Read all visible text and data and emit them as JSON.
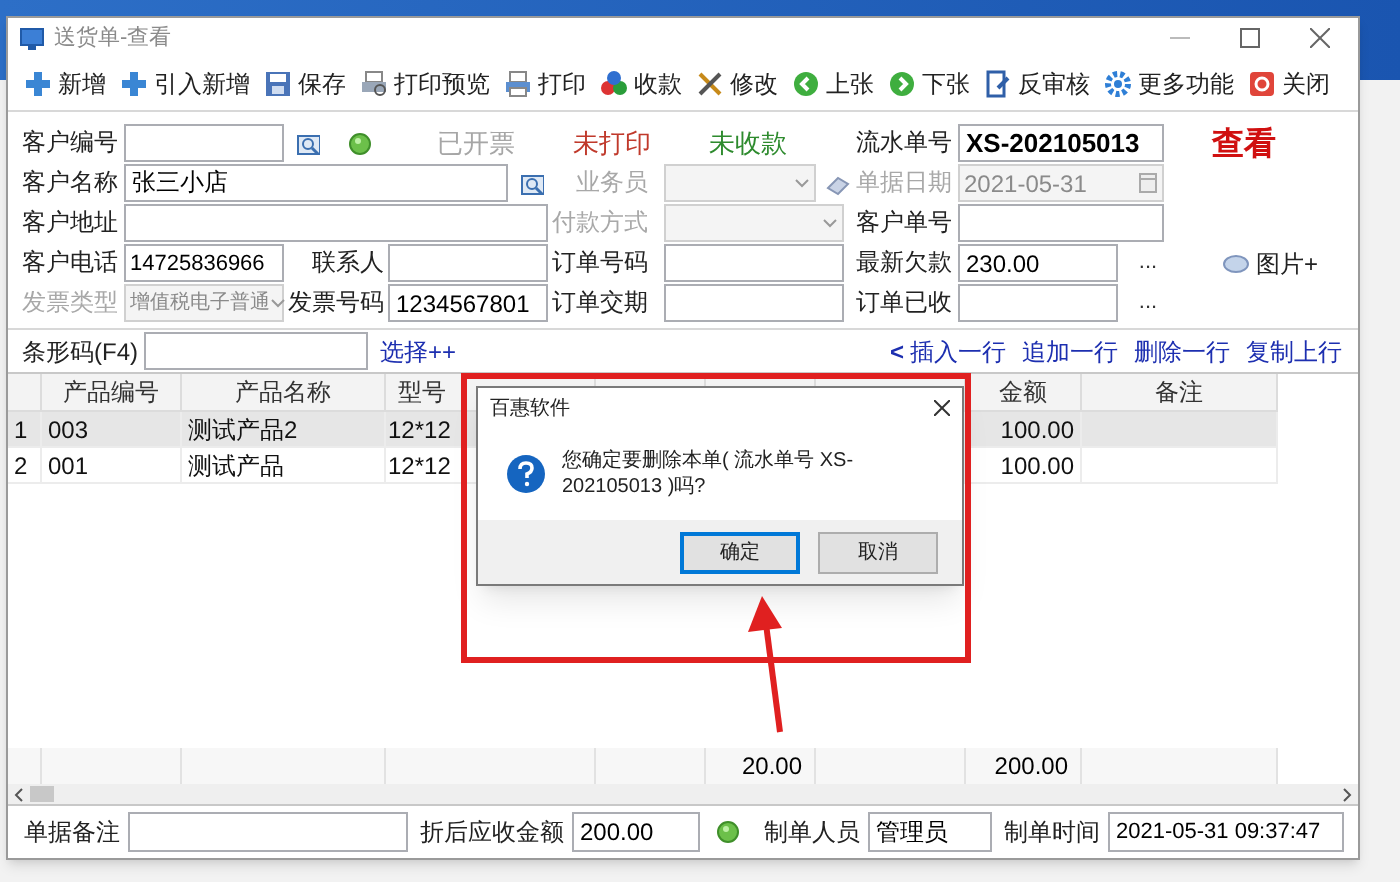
{
  "window": {
    "title": "送货单-查看"
  },
  "toolbar": [
    {
      "label": "新增"
    },
    {
      "label": "引入新增"
    },
    {
      "label": "保存"
    },
    {
      "label": "打印预览"
    },
    {
      "label": "打印"
    },
    {
      "label": "收款"
    },
    {
      "label": "修改"
    },
    {
      "label": "上张"
    },
    {
      "label": "下张"
    },
    {
      "label": "反审核"
    },
    {
      "label": "更多功能"
    },
    {
      "label": "关闭"
    }
  ],
  "statuses": [
    {
      "text": "已开票",
      "color": "#a6a6a6"
    },
    {
      "text": "未打印",
      "color": "#c0392b"
    },
    {
      "text": "未收款",
      "color": "#2e8b2e"
    }
  ],
  "mode_stamp": "查看",
  "form": {
    "customer_code": {
      "label": "客户编号",
      "disabled": false
    },
    "serial_no": {
      "label": "流水单号",
      "value": "XS-202105013",
      "disabled": false
    },
    "customer_name": {
      "label": "客户名称",
      "value": "张三小店",
      "disabled": false
    },
    "salesperson": {
      "label": "业务员",
      "disabled": true
    },
    "bill_date": {
      "label": "单据日期",
      "value": "2021-05-31",
      "disabled": true
    },
    "address": {
      "label": "客户地址",
      "disabled": false
    },
    "payment_method": {
      "label": "付款方式",
      "disabled": true
    },
    "customer_order_no": {
      "label": "客户单号",
      "disabled": false
    },
    "phone": {
      "label": "客户电话",
      "value": "14725836966",
      "disabled": false
    },
    "contact": {
      "label": "联系人",
      "disabled": false
    },
    "order_no": {
      "label": "订单号码",
      "disabled": false
    },
    "latest_debt": {
      "label": "最新欠款",
      "value": "230.00",
      "disabled": false
    },
    "invoice_type": {
      "label": "发票类型",
      "value": "增值税电子普通",
      "disabled": true
    },
    "invoice_no": {
      "label": "发票号码",
      "value": "1234567801",
      "disabled": false
    },
    "delivery_date": {
      "label": "订单交期",
      "disabled": false
    },
    "order_received": {
      "label": "订单已收",
      "disabled": false
    }
  },
  "more_buttons": [
    "...",
    "..."
  ],
  "images_button": "图片+",
  "barcode": {
    "label": "条形码(F4)"
  },
  "select_link": "选择++",
  "row_nav": "<",
  "row_actions": [
    "插入一行",
    "追加一行",
    "删除一行",
    "复制上行"
  ],
  "table": {
    "columns": [
      "产品编号",
      "产品名称",
      "型号",
      "金额",
      "备注"
    ],
    "rows": [
      {
        "no": "1",
        "code": "003",
        "name": "测试产品2",
        "spec": "12*12",
        "amount": "100.00",
        "selected": true
      },
      {
        "no": "2",
        "code": "001",
        "name": "测试产品",
        "spec": "12*12",
        "amount": "100.00",
        "selected": false
      }
    ],
    "totals": {
      "quantity": "20.00",
      "amount": "200.00"
    }
  },
  "footer": {
    "remark": {
      "label": "单据备注"
    },
    "discounted_total": {
      "label": "折后应收金额",
      "value": "200.00"
    },
    "creator": {
      "label": "制单人员",
      "value": "管理员"
    },
    "created_time": {
      "label": "制单时间",
      "value": "2021-05-31 09:37:47"
    }
  },
  "dialog": {
    "title": "百惠软件",
    "message": "您确定要删除本单( 流水单号 XS-202105013 )吗?",
    "buttons": [
      {
        "label": "确定",
        "selected": true
      },
      {
        "label": "取消",
        "selected": false
      }
    ]
  }
}
